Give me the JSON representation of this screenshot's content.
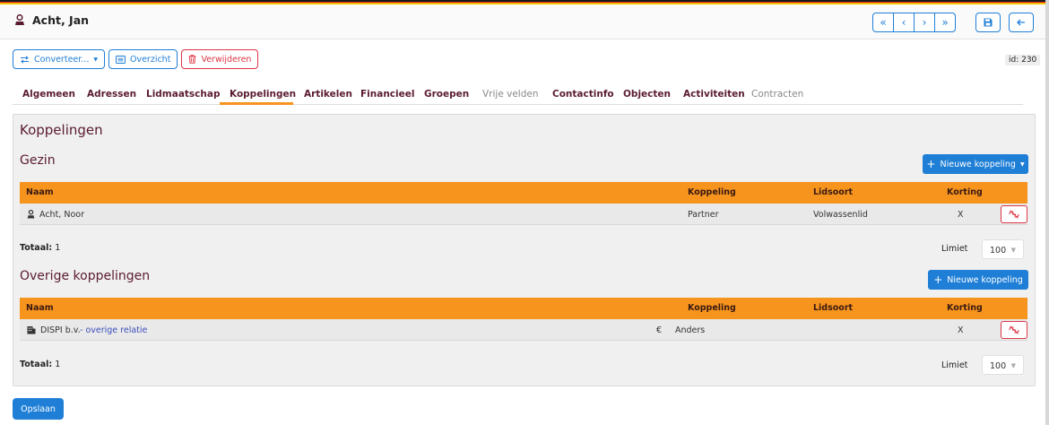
{
  "header": {
    "title": "Acht, Jan",
    "nav": [
      "«",
      "‹",
      "›",
      "»"
    ],
    "save_icon": "floppy-icon",
    "back_icon": "arrow-left-icon",
    "flag_colors": [
      "#1a1a1a",
      "#dd2222",
      "#f5c400"
    ]
  },
  "actions": {
    "convert_label": "Converteer...",
    "overview_label": "Overzicht",
    "delete_label": "Verwijderen",
    "id_label": "id: 230"
  },
  "tabs": [
    {
      "label": "Algemeen",
      "state": "normal"
    },
    {
      "label": "Adressen",
      "state": "normal"
    },
    {
      "label": "Lidmaatschap",
      "state": "normal"
    },
    {
      "label": "Koppelingen",
      "state": "active"
    },
    {
      "label": "Artikelen",
      "state": "normal"
    },
    {
      "label": "Financieel",
      "state": "normal"
    },
    {
      "label": "Groepen",
      "state": "normal"
    },
    {
      "label": "Vrije velden",
      "state": "muted"
    },
    {
      "label": "Contactinfo",
      "state": "normal"
    },
    {
      "label": "Objecten",
      "state": "normal"
    },
    {
      "label": "Activiteiten",
      "state": "normal"
    },
    {
      "label": "Contracten",
      "state": "muted"
    }
  ],
  "panel": {
    "title": "Koppelingen",
    "gezin": {
      "title": "Gezin",
      "new_button": "Nieuwe koppeling",
      "columns": [
        "Naam",
        "Koppeling",
        "Lidsoort",
        "Korting"
      ],
      "rows": [
        {
          "naam": "Acht, Noor",
          "koppeling": "Partner",
          "lidsoort": "Volwassenlid",
          "korting": "X"
        }
      ],
      "total_label": "Totaal:",
      "total_value": "1",
      "limit_label": "Limiet",
      "limit_value": "100"
    },
    "overige": {
      "title": "Overige koppelingen",
      "new_button": "Nieuwe koppeling",
      "columns": [
        "Naam",
        "Koppeling",
        "Lidsoort",
        "Korting"
      ],
      "rows": [
        {
          "naam": "DISPI b.v.",
          "link": "- overige relatie",
          "currency": "€",
          "koppeling": "Anders",
          "lidsoort": "",
          "korting": "X"
        }
      ],
      "total_label": "Totaal:",
      "total_value": "1",
      "limit_label": "Limiet",
      "limit_value": "100"
    }
  },
  "footer": {
    "save_label": "Opslaan"
  }
}
